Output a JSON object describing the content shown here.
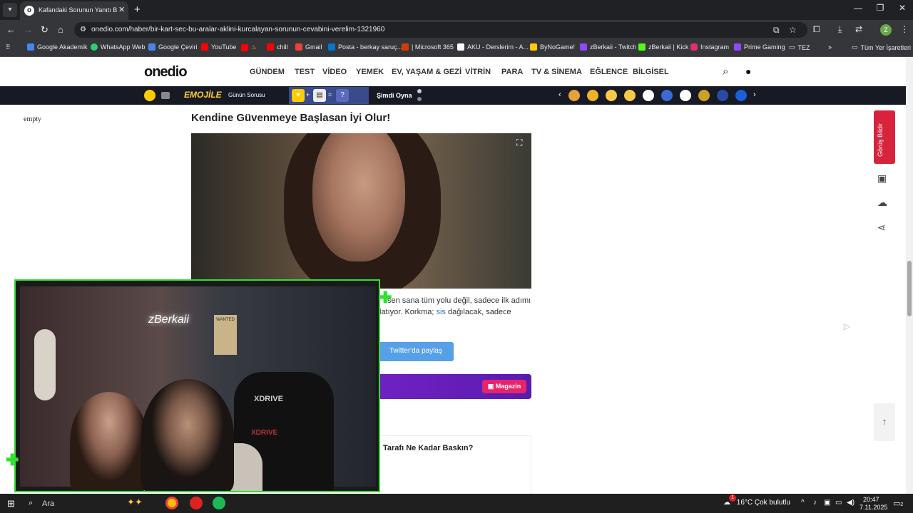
{
  "browser": {
    "tab_title": "Kafandaki Sorunun Yanıtı Bu Ku",
    "url": "onedio.com/haber/bir-kart-sec-bu-aralar-aklini-kurcalayan-sorunun-cevabini-verelim-1321960",
    "profile_initial": "Z",
    "bookmarks": [
      "Google Akademik",
      "WhatsApp Web",
      "Google Çeviri",
      "YouTube",
      "",
      "chill",
      "Gmail",
      "Posta - berkay saruç...",
      "| Microsoft 365",
      "AKU - Derslerim - A...",
      "ByNoGame!",
      "zBerkaii - Twitch",
      "zBerkaii | Kick",
      "Instagram",
      "Prime Gaming",
      "TEZ"
    ],
    "all_bookmarks": "Tüm Yer İşaretleri"
  },
  "site": {
    "logo": "onedio",
    "nav": [
      "GÜNDEM",
      "TEST",
      "VİDEO",
      "YEMEK",
      "EV, YAŞAM & GEZİ",
      "VİTRİN",
      "PARA",
      "TV & SİNEMA",
      "EĞLENCE",
      "BİLGİSEL"
    ]
  },
  "promo": {
    "brand": "EMOJİLE",
    "daily_question": "Günün Sorusu",
    "play_now": "Şimdi Oyna",
    "puzzle_symbols": [
      "+",
      "=",
      "?"
    ]
  },
  "article": {
    "empty_label": "empty",
    "title": "Kendine Güvenmeye Başlasan İyi Olur!",
    "body_part1": "sen sana tüm yolu değil, sadece ilk adımı",
    "body_part2": "latıyor. Korkma;",
    "body_link": "sis",
    "body_part3": "dağılacak, sadece",
    "twitter_share": "Twitter'da paylaş",
    "magazin": "Magazin",
    "quiz_title": "Tarafı Ne Kadar Baskın?"
  },
  "sidebar": {
    "feedback": "Görüş Bildir"
  },
  "webcam": {
    "neon_sign": "zBerkaii",
    "poster": "WANTED",
    "chair_logo": "XDRIVE"
  },
  "taskbar": {
    "search": "Ara",
    "weather": "16°C  Çok bulutlu",
    "time": "20:47",
    "date": "7.11.2025",
    "notification_count": "2",
    "weather_alert_count": "1"
  },
  "colors": {
    "accent_green": "#2fe02f",
    "feedback_red": "#d9233d",
    "twitter_blue": "#55a0e6",
    "magazin_pink": "#e6246a"
  }
}
